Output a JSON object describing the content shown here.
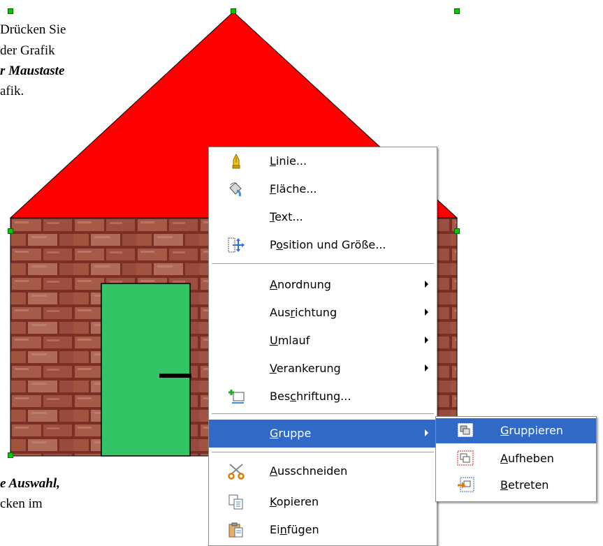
{
  "doc": {
    "line1": "Drücken Sie",
    "line2": "der Grafik",
    "line3": "r Maustaste",
    "line4": "afik.",
    "line5": "e Auswahl,",
    "line6": "cken im"
  },
  "colors": {
    "roof": "#ff0000",
    "door": "#33c466",
    "brick": "#8b3a2e",
    "handle": "#00cc00",
    "menu_highlight": "#3169c6"
  },
  "context_menu": {
    "items": [
      {
        "pre": "",
        "key": "L",
        "post": "inie...",
        "icon": "pen-icon"
      },
      {
        "pre": "",
        "key": "F",
        "post": "läche...",
        "icon": "paint-bucket-icon"
      },
      {
        "pre": "",
        "key": "T",
        "post": "ext...",
        "icon": ""
      },
      {
        "pre": "P",
        "key": "o",
        "post": "sition und Größe...",
        "icon": "position-size-icon"
      },
      {
        "pre": "",
        "key": "A",
        "post": "nordnung",
        "submenu": true
      },
      {
        "pre": "Aus",
        "key": "r",
        "post": "ichtung",
        "submenu": true
      },
      {
        "pre": "",
        "key": "U",
        "post": "mlauf",
        "submenu": true
      },
      {
        "pre": "",
        "key": "V",
        "post": "erankerung",
        "submenu": true
      },
      {
        "pre": "Bes",
        "key": "c",
        "post": "hriftung...",
        "icon": "caption-icon"
      },
      {
        "pre": "",
        "key": "G",
        "post": "ruppe",
        "submenu": true,
        "selected": true
      },
      {
        "pre": "",
        "key": "A",
        "post": "usschneiden",
        "icon": "scissors-icon"
      },
      {
        "pre": "",
        "key": "K",
        "post": "opieren",
        "icon": "copy-icon"
      },
      {
        "pre": "Ei",
        "key": "n",
        "post": "fügen",
        "icon": "paste-icon"
      }
    ]
  },
  "group_submenu": {
    "items": [
      {
        "pre": "",
        "key": "G",
        "post": "ruppieren",
        "icon": "group-icon",
        "selected": true
      },
      {
        "pre": "",
        "key": "A",
        "post": "ufheben",
        "icon": "ungroup-icon"
      },
      {
        "pre": "",
        "key": "B",
        "post": "etreten",
        "icon": "enter-group-icon"
      }
    ]
  }
}
